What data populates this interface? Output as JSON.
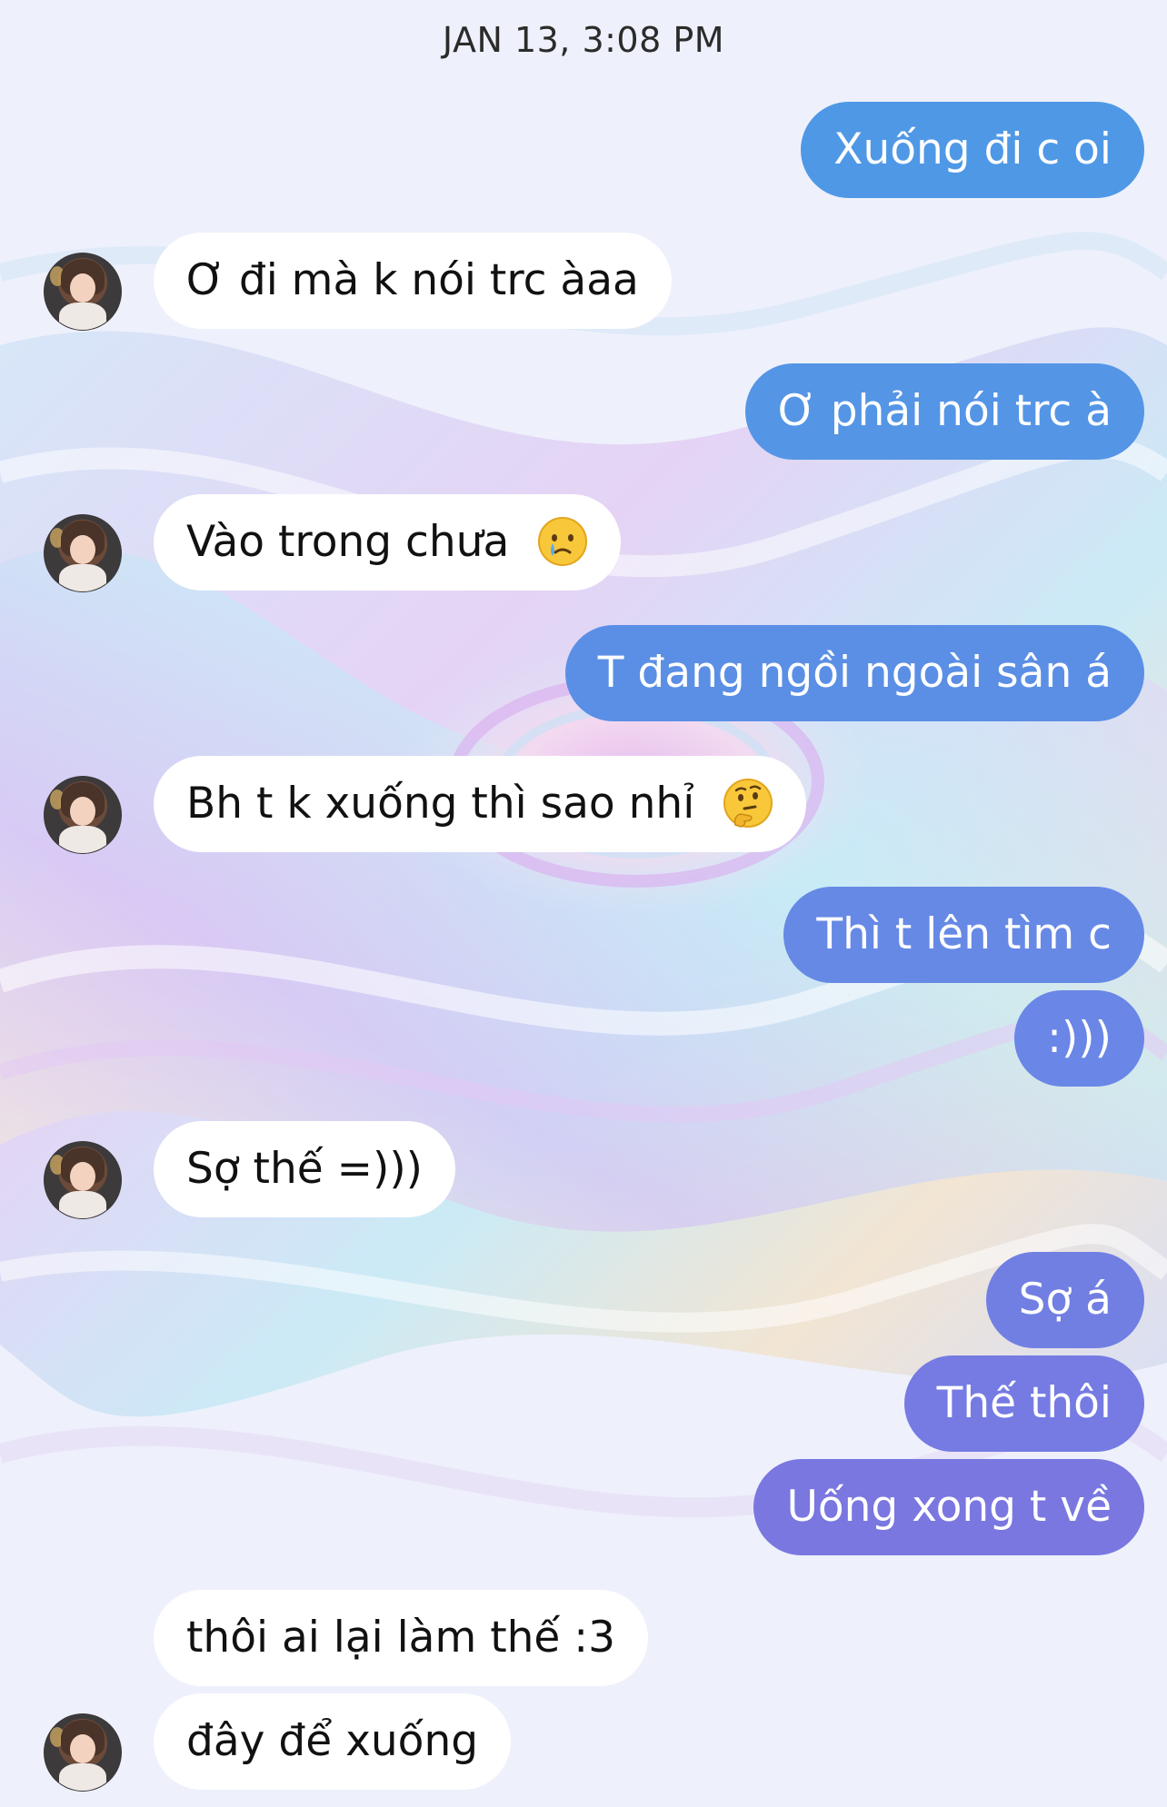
{
  "header": {
    "timestamp": "JAN 13, 3:08 PM"
  },
  "colors": {
    "incoming_bubble": "#ffffff",
    "outgoing_top": "#4f9ae8",
    "outgoing_bottom": "#7a77e0"
  },
  "messages": [
    {
      "from": "me",
      "text": "Xuống đi c oi"
    },
    {
      "from": "them",
      "text": "Ơ đi mà k nói trc àaa",
      "avatar": true
    },
    {
      "from": "me",
      "text": "Ơ phải nói trc à"
    },
    {
      "from": "them",
      "text": "Vào trong chưa",
      "emoji": "crying-face",
      "avatar": true
    },
    {
      "from": "me",
      "text": "T đang ngồi ngoài sân á"
    },
    {
      "from": "them",
      "text": "Bh t k xuống thì sao nhỉ",
      "emoji": "thinking-face",
      "avatar": true
    },
    {
      "from": "me",
      "text": "Thì t lên tìm c"
    },
    {
      "from": "me",
      "text": ":)))"
    },
    {
      "from": "them",
      "text": "Sợ thế =)))",
      "avatar": true
    },
    {
      "from": "me",
      "text": "Sợ á"
    },
    {
      "from": "me",
      "text": "Thế thôi"
    },
    {
      "from": "me",
      "text": "Uống xong t về"
    },
    {
      "from": "them",
      "text": "thôi ai lại làm thế :3",
      "avatar": false
    },
    {
      "from": "them",
      "text": "đây để xuống",
      "avatar": true
    }
  ]
}
